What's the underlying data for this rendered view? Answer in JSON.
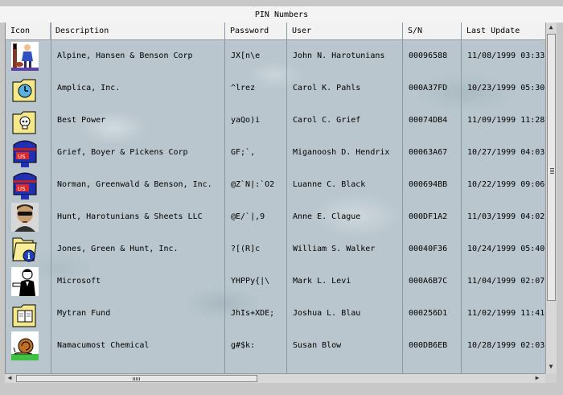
{
  "window": {
    "title": "PIN Numbers"
  },
  "columns": [
    "Icon",
    "Description",
    "Password",
    "User",
    "S/N",
    "Last Update"
  ],
  "rows": [
    {
      "icon": "person-with-dog-icon",
      "description": "Alpine, Hansen & Benson Corp",
      "password": "JX[n\\e",
      "user": "John N. Harotunians",
      "sn": "00096588",
      "updated": "11/08/1999 03:33"
    },
    {
      "icon": "clock-folder-icon",
      "description": "Amplica, Inc.",
      "password": "^lrez",
      "user": "Carol K. Pahls",
      "sn": "000A37FD",
      "updated": "10/23/1999 05:30"
    },
    {
      "icon": "skull-folder-icon",
      "description": "Best Power",
      "password": "yaQo)i",
      "user": "Carol C. Grief",
      "sn": "00074DB4",
      "updated": "11/09/1999 11:28"
    },
    {
      "icon": "mailbox-us-icon",
      "description": "Grief, Boyer & Pickens Corp",
      "password": "GF;`,",
      "user": "Miganoosh D. Hendrix",
      "sn": "00063A67",
      "updated": "10/27/1999 04:03"
    },
    {
      "icon": "mailbox-us-icon",
      "description": "Norman, Greenwald & Benson, Inc.",
      "password": "@Z`N|:`O2",
      "user": "Luanne C. Black",
      "sn": "000694BB",
      "updated": "10/22/1999 09:06"
    },
    {
      "icon": "man-sunglasses-photo-icon",
      "description": "Hunt, Harotunians & Sheets LLC",
      "password": "@E/`|,9",
      "user": "Anne E. Clague",
      "sn": "000DF1A2",
      "updated": "11/03/1999 04:02"
    },
    {
      "icon": "info-folder-icon",
      "description": "Jones, Green & Hunt, Inc.",
      "password": "?[(R]c",
      "user": "William S. Walker",
      "sn": "00040F36",
      "updated": "10/24/1999 05:40"
    },
    {
      "icon": "businessman-icon",
      "description": "Microsoft",
      "password": "YHPPy{|\\",
      "user": "Mark L. Levi",
      "sn": "000A6B7C",
      "updated": "11/04/1999 02:07"
    },
    {
      "icon": "book-folder-icon",
      "description": "Mytran Fund",
      "password": "JhIs+XDE;",
      "user": "Joshua L. Blau",
      "sn": "000256D1",
      "updated": "11/02/1999 11:41"
    },
    {
      "icon": "snail-icon",
      "description": "Namacumost Chemical",
      "password": "g#$k:",
      "user": "Susan Blow",
      "sn": "000DB6EB",
      "updated": "10/28/1999 02:03"
    }
  ],
  "scrollbars": {
    "vertical_position": 0.0,
    "horizontal_position": 0.0
  }
}
